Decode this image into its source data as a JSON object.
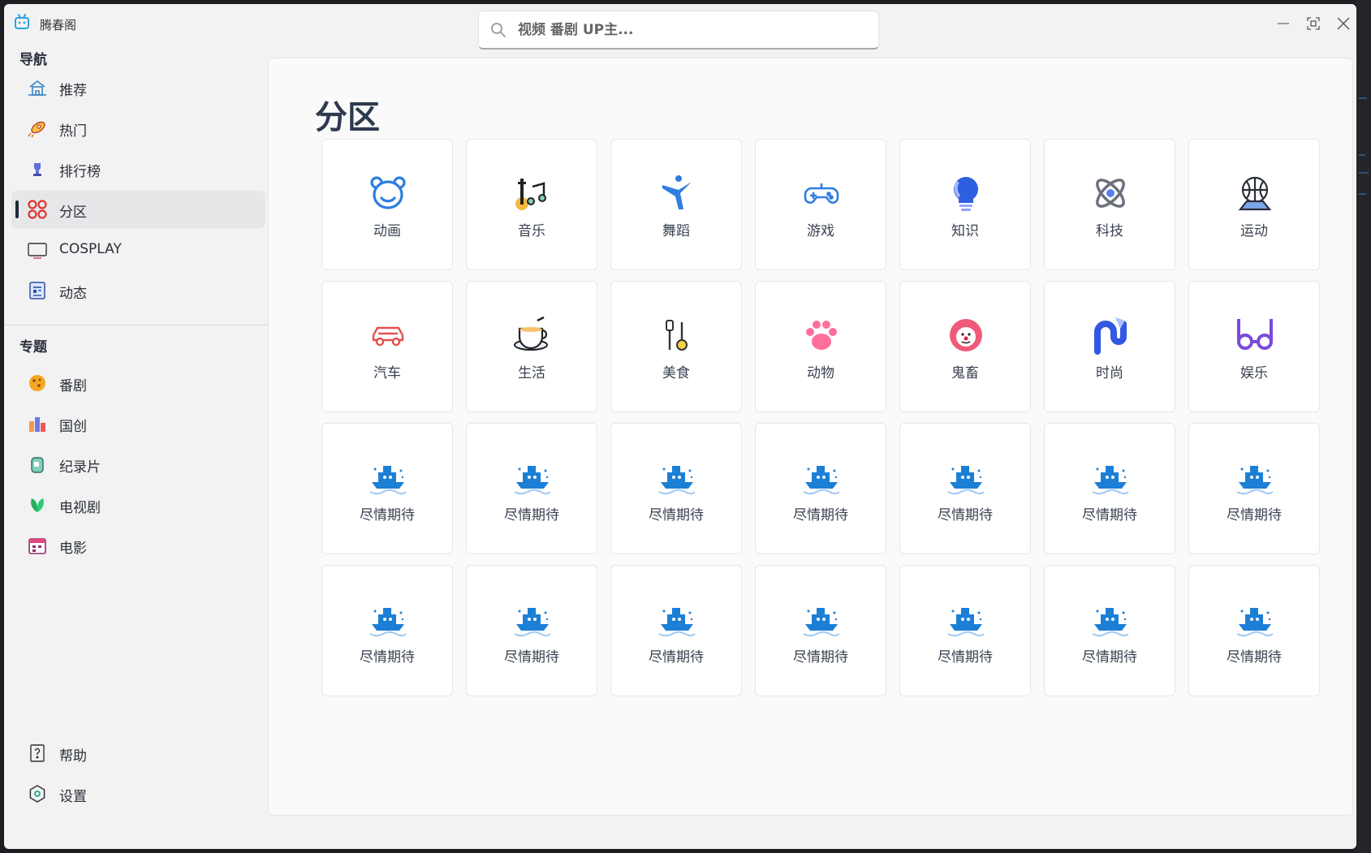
{
  "app": {
    "title": "腾春阁",
    "accent": "#2aa3e0"
  },
  "search": {
    "placeholder": "视频 番剧 UP主..."
  },
  "sidebar": {
    "nav_title": "导航",
    "nav_items": [
      {
        "label": "推荐",
        "icon": "home-icon"
      },
      {
        "label": "热门",
        "icon": "rocket-icon"
      },
      {
        "label": "排行榜",
        "icon": "trophy-icon"
      },
      {
        "label": "分区",
        "icon": "grid-icon",
        "active": true
      },
      {
        "label": "COSPLAY",
        "icon": "tv-icon"
      },
      {
        "label": "动态",
        "icon": "news-icon"
      }
    ],
    "topic_title": "专题",
    "topic_items": [
      {
        "label": "番剧",
        "icon": "cookie-icon"
      },
      {
        "label": "国创",
        "icon": "buildings-icon"
      },
      {
        "label": "纪录片",
        "icon": "jar-icon"
      },
      {
        "label": "电视剧",
        "icon": "leaf-icon"
      },
      {
        "label": "电影",
        "icon": "calendar-icon"
      }
    ],
    "footer_items": [
      {
        "label": "帮助",
        "icon": "help-icon"
      },
      {
        "label": "设置",
        "icon": "settings-icon"
      }
    ]
  },
  "main": {
    "title": "分区",
    "cards": [
      {
        "label": "动画",
        "icon": "bear-icon"
      },
      {
        "label": "音乐",
        "icon": "music-icon"
      },
      {
        "label": "舞蹈",
        "icon": "dancer-icon"
      },
      {
        "label": "游戏",
        "icon": "gamepad-icon"
      },
      {
        "label": "知识",
        "icon": "bulb-icon"
      },
      {
        "label": "科技",
        "icon": "atom-icon"
      },
      {
        "label": "运动",
        "icon": "basketball-icon"
      },
      {
        "label": "汽车",
        "icon": "car-icon"
      },
      {
        "label": "生活",
        "icon": "coffee-icon"
      },
      {
        "label": "美食",
        "icon": "cooking-icon"
      },
      {
        "label": "动物",
        "icon": "paw-icon"
      },
      {
        "label": "鬼畜",
        "icon": "clown-icon"
      },
      {
        "label": "时尚",
        "icon": "fashion-icon"
      },
      {
        "label": "娱乐",
        "icon": "glasses-icon"
      },
      {
        "label": "尽情期待",
        "icon": "ship-icon"
      },
      {
        "label": "尽情期待",
        "icon": "ship-icon"
      },
      {
        "label": "尽情期待",
        "icon": "ship-icon"
      },
      {
        "label": "尽情期待",
        "icon": "ship-icon"
      },
      {
        "label": "尽情期待",
        "icon": "ship-icon"
      },
      {
        "label": "尽情期待",
        "icon": "ship-icon"
      },
      {
        "label": "尽情期待",
        "icon": "ship-icon"
      },
      {
        "label": "尽情期待",
        "icon": "ship-icon"
      },
      {
        "label": "尽情期待",
        "icon": "ship-icon"
      },
      {
        "label": "尽情期待",
        "icon": "ship-icon"
      },
      {
        "label": "尽情期待",
        "icon": "ship-icon"
      },
      {
        "label": "尽情期待",
        "icon": "ship-icon"
      },
      {
        "label": "尽情期待",
        "icon": "ship-icon"
      },
      {
        "label": "尽情期待",
        "icon": "ship-icon"
      }
    ]
  }
}
